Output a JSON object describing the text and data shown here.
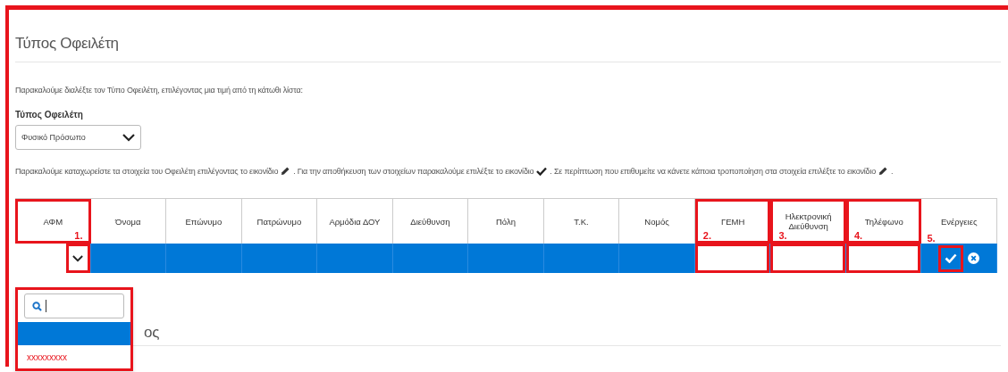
{
  "section": {
    "title": "Τύπος Οφειλέτη"
  },
  "intro": "Παρακαλούμε διαλέξτε τον Τύπο Οφειλέτη, επιλέγοντας μια τιμή από τη κάτωθι λίστα:",
  "type_field": {
    "label": "Τύπος Οφειλέτη",
    "value": "Φυσικό Πρόσωπο"
  },
  "instructions": [
    "Παρακαλούμε καταχωρείστε τα στοιχεία του Οφειλέτη επιλέγοντας το εικονίδιο",
    ". Για την αποθήκευση των στοιχείων παρακαλούμε επιλέξτε το εικονίδιο",
    ". Σε περίπτωση που επιθυμείτε να κάνετε κάποια τροποποίηση στα στοιχεία επιλέξτε το εικονίδιο",
    "."
  ],
  "table": {
    "columns": [
      {
        "label": "ΑΦΜ",
        "highlighted": true,
        "marker": "1."
      },
      {
        "label": "Όνομα",
        "highlighted": false
      },
      {
        "label": "Επώνυμο",
        "highlighted": false
      },
      {
        "label": "Πατρώνυμο",
        "highlighted": false
      },
      {
        "label": "Αρμόδια ΔΟΥ",
        "highlighted": false
      },
      {
        "label": "Διεύθυνση",
        "highlighted": false
      },
      {
        "label": "Πόλη",
        "highlighted": false
      },
      {
        "label": "Τ.Κ.",
        "highlighted": false
      },
      {
        "label": "Νομός",
        "highlighted": false
      },
      {
        "label": "ΓΕΜΗ",
        "highlighted": true,
        "marker": "2."
      },
      {
        "label": "Ηλεκτρονική Διεύθυνση",
        "highlighted": true,
        "marker": "3."
      },
      {
        "label": "Τηλέφωνο",
        "highlighted": true,
        "marker": "4."
      },
      {
        "label": "Ενέργειες",
        "highlighted": false,
        "marker": "5."
      }
    ],
    "row": {
      "selected": true,
      "cells": [
        {
          "kind": "select",
          "highlighted": true
        },
        {
          "kind": "blank"
        },
        {
          "kind": "blank"
        },
        {
          "kind": "blank"
        },
        {
          "kind": "blank"
        },
        {
          "kind": "blank"
        },
        {
          "kind": "blank"
        },
        {
          "kind": "blank"
        },
        {
          "kind": "blank"
        },
        {
          "kind": "input",
          "highlighted": true
        },
        {
          "kind": "input",
          "highlighted": true
        },
        {
          "kind": "input",
          "highlighted": true
        },
        {
          "kind": "actions",
          "highlighted": true
        }
      ]
    }
  },
  "dropdown": {
    "options": [
      {
        "selected": true
      },
      {
        "label": "xxxxxxxxx",
        "selected": false
      }
    ]
  },
  "next_section": {
    "title": "ος"
  }
}
